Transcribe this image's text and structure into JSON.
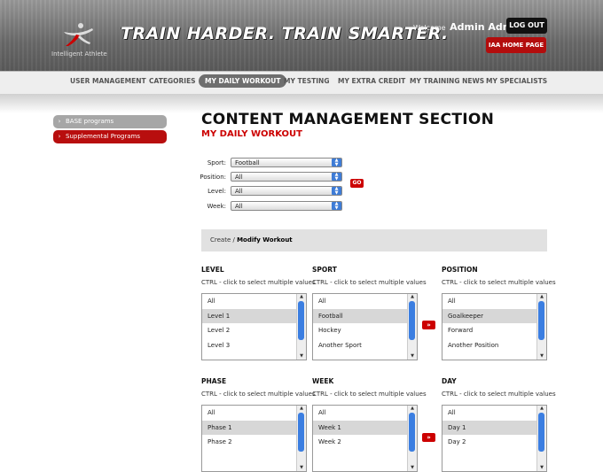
{
  "header": {
    "logo_text": "Intelligent Athlete",
    "tagline": "TRAIN HARDER. TRAIN SMARTER.",
    "welcome_label": "Welcome",
    "user_name": "Admin Admin",
    "logout_label": "LOG OUT",
    "home_label": "IAA HOME PAGE"
  },
  "nav": {
    "items": [
      "USER MANAGEMENT",
      "CATEGORIES",
      "MY DAILY WORKOUT",
      "MY TESTING",
      "MY EXTRA CREDIT",
      "MY TRAINING NEWS",
      "MY SPECIALISTS"
    ],
    "active": "MY DAILY WORKOUT"
  },
  "sidebar": {
    "items": [
      {
        "label": "BASE programs",
        "color": "#a6a6a6"
      },
      {
        "label": "Supplemental Programs",
        "color": "#b80e0e"
      }
    ]
  },
  "main": {
    "title": "CONTENT MANAGEMENT SECTION",
    "subtitle": "MY DAILY WORKOUT"
  },
  "filters": {
    "sport_label": "Sport:",
    "sport_value": "Football",
    "position_label": "Position:",
    "position_value": "All",
    "level_label": "Level:",
    "level_value": "All",
    "week_label": "Week:",
    "week_value": "All",
    "go_label": "GO"
  },
  "create_bar": {
    "prefix": "Create /",
    "bold": "Modify Workout"
  },
  "hint": "CTRL - click to select multiple values",
  "move_label": "»",
  "lists": {
    "level": {
      "title": "LEVEL",
      "options": [
        "All",
        "Level 1",
        "Level 2",
        "Level 3"
      ],
      "selected": 1
    },
    "sport": {
      "title": "SPORT",
      "options": [
        "All",
        "Football",
        "Hockey",
        "Another Sport"
      ],
      "selected": 1
    },
    "position": {
      "title": "POSITION",
      "options": [
        "All",
        "Goalkeeper",
        "Forward",
        "Another Position"
      ],
      "selected": 1
    },
    "phase": {
      "title": "PHASE",
      "options": [
        "All",
        "Phase 1",
        "Phase 2"
      ],
      "selected": 1
    },
    "week": {
      "title": "WEEK",
      "options": [
        "All",
        "Week 1",
        "Week 2"
      ],
      "selected": 1
    },
    "day": {
      "title": "DAY",
      "options": [
        "All",
        "Day 1",
        "Day 2"
      ],
      "selected": 1
    }
  },
  "colors": {
    "accent": "#b30d0d",
    "scroll_thumb": "#3b7ee1"
  }
}
